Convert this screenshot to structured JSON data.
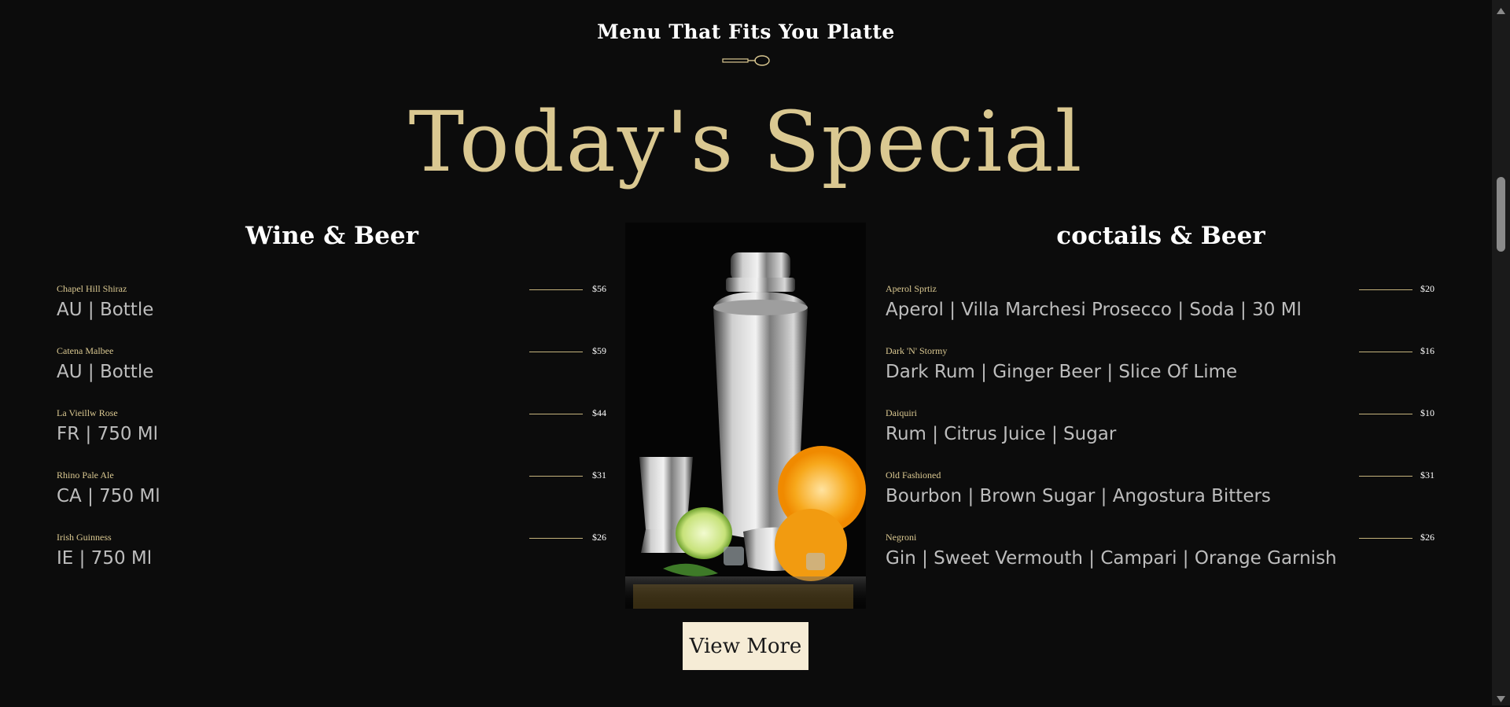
{
  "header": {
    "subtitle": "Menu That Fits You Platte",
    "title": "Today's Special"
  },
  "left_column": {
    "title": "Wine & Beer",
    "items": [
      {
        "name": "Chapel Hill Shiraz",
        "price": "$56",
        "desc": "AU | Bottle"
      },
      {
        "name": "Catena Malbee",
        "price": "$59",
        "desc": "AU | Bottle"
      },
      {
        "name": "La Vieillw Rose",
        "price": "$44",
        "desc": "FR | 750 Ml"
      },
      {
        "name": "Rhino Pale Ale",
        "price": "$31",
        "desc": "CA | 750 Ml"
      },
      {
        "name": "Irish Guinness",
        "price": "$26",
        "desc": "IE | 750 Ml"
      }
    ]
  },
  "right_column": {
    "title": "coctails & Beer",
    "items": [
      {
        "name": "Aperol Sprtiz",
        "price": "$20",
        "desc": "Aperol | Villa Marchesi Prosecco | Soda | 30 Ml"
      },
      {
        "name": "Dark 'N' Stormy",
        "price": "$16",
        "desc": "Dark Rum | Ginger Beer | Slice Of Lime"
      },
      {
        "name": "Daiquiri",
        "price": "$10",
        "desc": "Rum | Citrus Juice | Sugar"
      },
      {
        "name": "Old Fashioned",
        "price": "$31",
        "desc": "Bourbon | Brown Sugar | Angostura Bitters"
      },
      {
        "name": "Negroni",
        "price": "$26",
        "desc": "Gin | Sweet Vermouth | Campari | Orange Garnish"
      }
    ]
  },
  "actions": {
    "view_more_label": "View More"
  },
  "colors": {
    "background": "#0c0c0c",
    "accent_gold": "#dac891",
    "button_bg": "#f6ecd6"
  },
  "icons": {
    "divider": "spoon-icon",
    "photo": "cocktail-shaker-photo"
  }
}
